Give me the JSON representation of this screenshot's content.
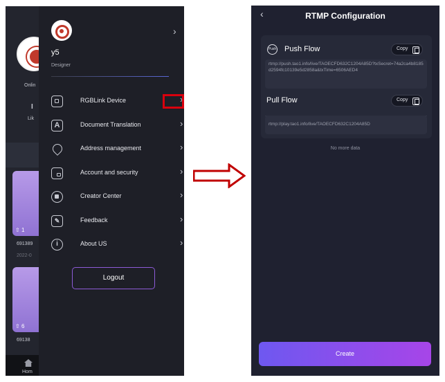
{
  "left_screen": {
    "background": {
      "status_short": "Onlin",
      "id_short": "I",
      "li_short": "Lik",
      "cards": [
        {
          "likes": "1",
          "id_text": "691389",
          "date_text": "2022-0"
        },
        {
          "likes": "6",
          "id_text": "69138"
        }
      ],
      "home_tab_short": "Hom"
    },
    "drawer": {
      "user_name": "y5",
      "user_role": "Designer",
      "chevron": "›",
      "menu_items": [
        {
          "label": "RGBLink Device",
          "icon": "device-icon"
        },
        {
          "label": "Document Translation",
          "icon": "translate-icon"
        },
        {
          "label": "Address management",
          "icon": "location-pin-icon"
        },
        {
          "label": "Account and security",
          "icon": "lock-icon"
        },
        {
          "label": "Creator Center",
          "icon": "grid-circle-icon"
        },
        {
          "label": "Feedback",
          "icon": "feedback-icon"
        },
        {
          "label": "About US",
          "icon": "info-icon"
        }
      ],
      "logout_label": "Logout"
    }
  },
  "right_screen": {
    "back_icon": "‹",
    "title": "RTMP Configuration",
    "push": {
      "label": "Push Flow",
      "icon_text": "Push",
      "copy_label": "Copy",
      "url": "rtmp://push.tao1.info/live/TAOECFD632C1204A85D?txSecret=74a2ca4b8185d2594fc10139e5d2858a&txTime=6506AED4"
    },
    "pull": {
      "label": "Pull Flow",
      "copy_label": "Copy",
      "url": "rtmp://play.tao1.info/live/TAOECFD632C1204A85D"
    },
    "empty_text": "No more data",
    "create_label": "Create"
  },
  "colors": {
    "highlight": "#d9000d",
    "arrow": "#c00000",
    "accent_start": "#6e58f0",
    "accent_end": "#a745e8",
    "drawer_bg": "#1e1f27",
    "page_bg": "#1f2130"
  }
}
